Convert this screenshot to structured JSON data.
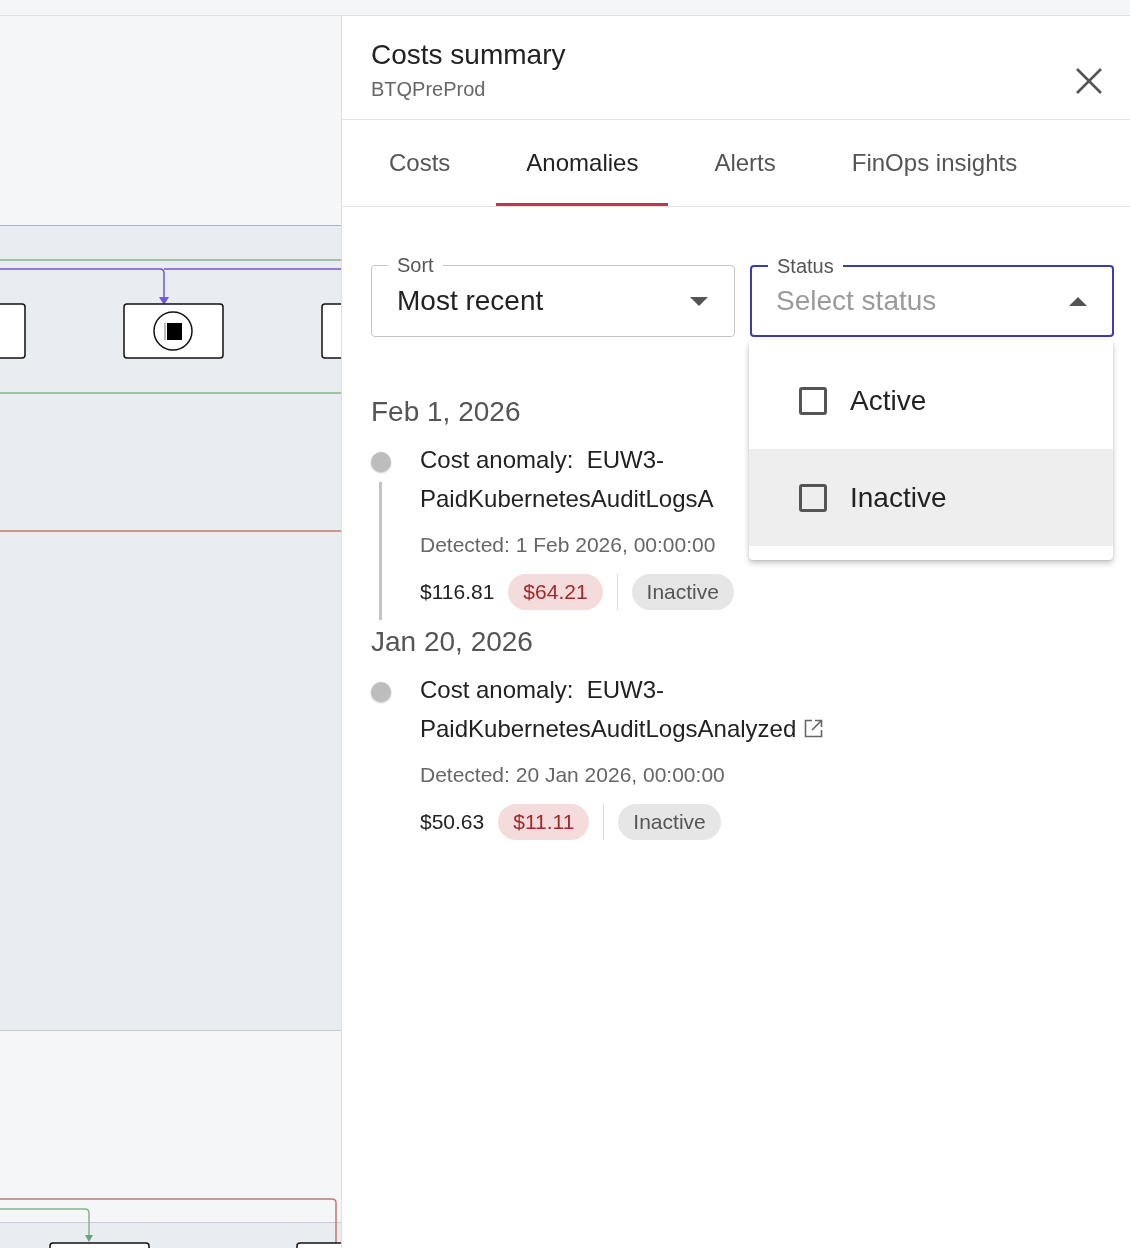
{
  "panel": {
    "title": "Costs summary",
    "subtitle": "BTQPreProd"
  },
  "tabs": [
    {
      "label": "Costs",
      "selected": false
    },
    {
      "label": "Anomalies",
      "selected": true
    },
    {
      "label": "Alerts",
      "selected": false
    },
    {
      "label": "FinOps insights",
      "selected": false
    }
  ],
  "sort": {
    "label": "Sort",
    "value": "Most recent"
  },
  "status": {
    "label": "Status",
    "placeholder": "Select status",
    "expanded": true,
    "options": [
      {
        "label": "Active",
        "checked": false,
        "focused": false
      },
      {
        "label": "Inactive",
        "checked": false,
        "focused": true
      }
    ]
  },
  "groups": [
    {
      "date": "Feb 1, 2026",
      "items": [
        {
          "title": "Cost anomaly:  EUW3-PaidKubernetesAuditLogsA",
          "external_link": false,
          "connector": true,
          "detected": "Detected: 1 Feb 2026, 00:00:00",
          "cost": "$116.81",
          "delta": "$64.21",
          "status": "Inactive"
        }
      ]
    },
    {
      "date": "Jan 20, 2026",
      "items": [
        {
          "title": "Cost anomaly:  EUW3-PaidKubernetesAuditLogsAnalyzed",
          "external_link": true,
          "connector": false,
          "detected": "Detected: 20 Jan 2026, 00:00:00",
          "cost": "$50.63",
          "delta": "$11.11",
          "status": "Inactive"
        }
      ]
    }
  ]
}
